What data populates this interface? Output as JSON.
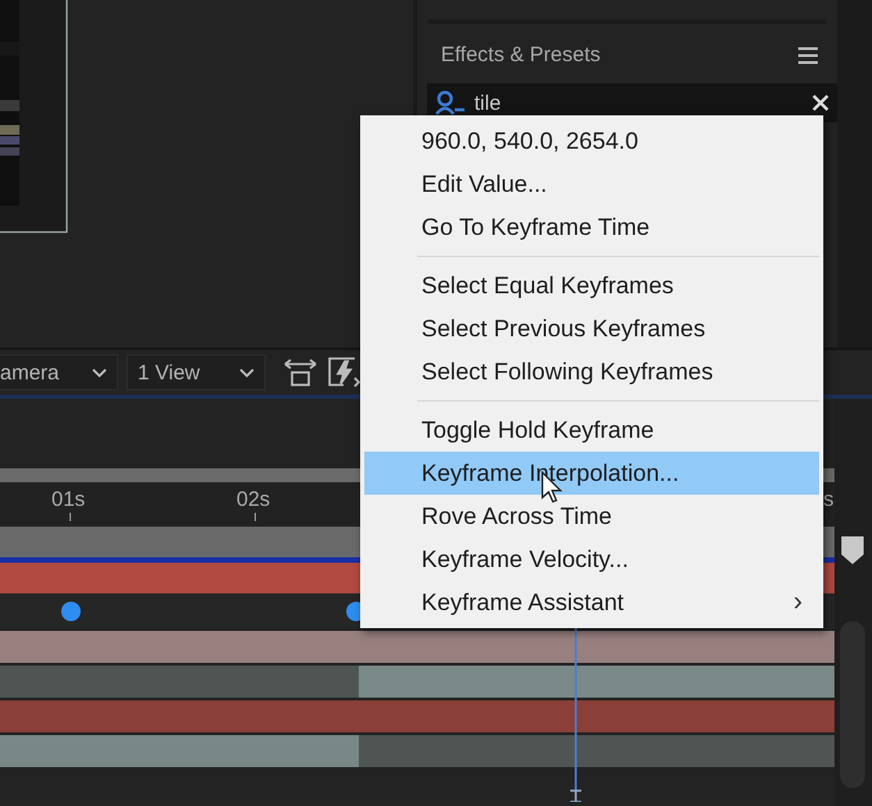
{
  "effects_panel": {
    "title": "Effects & Presets",
    "search": {
      "value": "tile"
    }
  },
  "viewer_toolbar": {
    "dropdowns": [
      "amera",
      "1 View"
    ]
  },
  "timeline": {
    "ruler_labels": [
      "01s",
      "02s",
      "s"
    ]
  },
  "context_menu": {
    "groups": [
      [
        {
          "label": "960.0, 540.0, 2654.0",
          "selected": false
        },
        {
          "label": "Edit Value...",
          "selected": false
        },
        {
          "label": "Go To Keyframe Time",
          "selected": false
        }
      ],
      [
        {
          "label": "Select Equal Keyframes",
          "selected": false
        },
        {
          "label": "Select Previous Keyframes",
          "selected": false
        },
        {
          "label": "Select Following Keyframes",
          "selected": false
        }
      ],
      [
        {
          "label": "Toggle Hold Keyframe",
          "selected": false
        },
        {
          "label": "Keyframe Interpolation...",
          "selected": true
        },
        {
          "label": "Rove Across Time",
          "selected": false
        },
        {
          "label": "Keyframe Velocity...",
          "selected": false
        },
        {
          "label": "Keyframe Assistant",
          "selected": false,
          "arrow": "›"
        }
      ]
    ]
  }
}
